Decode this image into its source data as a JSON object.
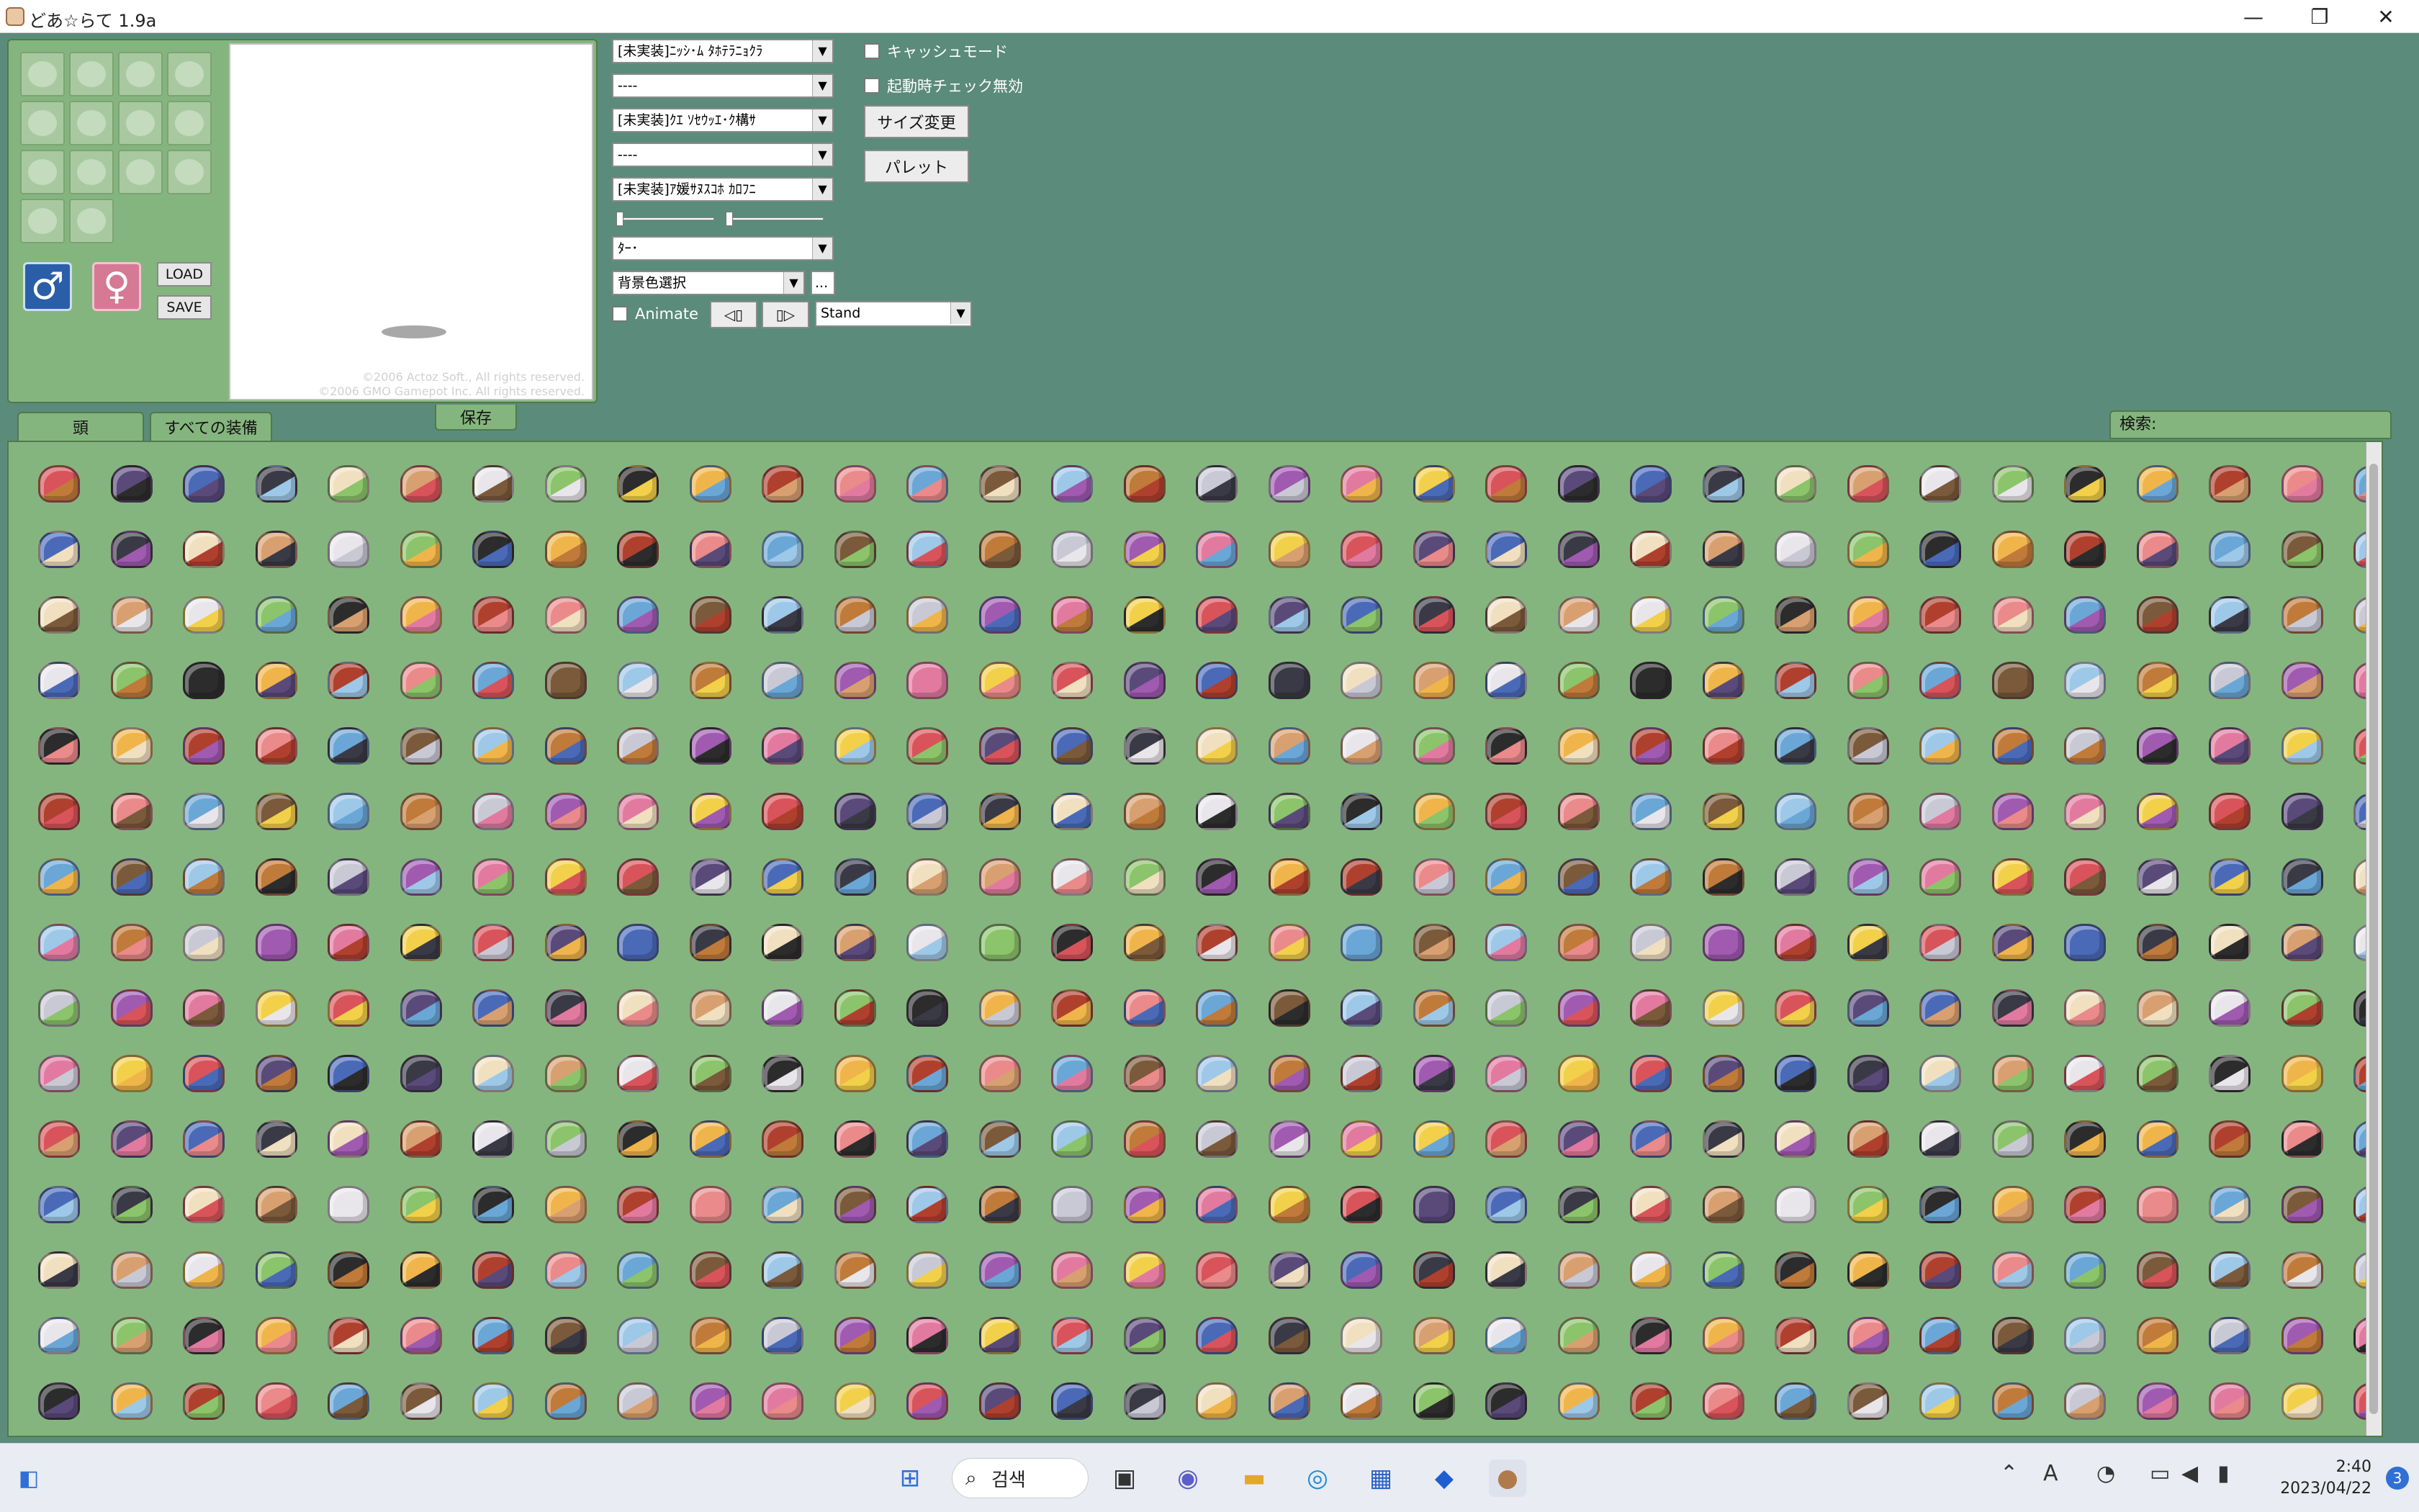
{
  "window": {
    "title": "どあ☆らて 1.9a",
    "minimize_glyph": "—",
    "restore_glyph": "❐",
    "close_glyph": "✕"
  },
  "equip_panel": {
    "slot_icons": [
      "hat-upper-icon",
      "glasses-icon",
      "hat-mid-icon",
      "weapon-icon",
      "shield-icon",
      "armor-icon",
      "helmet-icon",
      "accessory-icon",
      "glove-icon",
      "shoes-icon",
      "boots-icon",
      "face-icon",
      "hand-icon",
      "ring-icon"
    ],
    "male_glyph": "♂",
    "female_glyph": "♀",
    "load_label": "LOAD",
    "save_label": "SAVE",
    "copyright_1": "©2006 Actoz Soft., All rights reserved.",
    "copyright_2": "©2006 GMO Gamepot Inc. All rights reserved."
  },
  "controls": {
    "combo_1": "[未実装]ﾆｯｼ･ﾑ ﾀﾎﾃﾗﾆｮｸﾗ",
    "combo_2": "----",
    "combo_3": "[未実装]ｸｴ ｿｾｳｯｴ･ｸ構ｻ",
    "combo_4": "----",
    "combo_5": "[未実装]ｱ媛ｻﾇｽｺﾎ ｶﾛﾌﾆ",
    "combo_6": "ﾀｰ･",
    "bg_color": "背景色選択",
    "bg_more": "...",
    "animate_label": "Animate",
    "prev_frame": "◁▯",
    "next_frame": "▯▷",
    "motion": "Stand",
    "cache_mode_label": "キャッシュモード",
    "startup_check_label": "起動時チェック無効",
    "resize_label": "サイズ変更",
    "palette_label": "パレット"
  },
  "tabs": {
    "head": "頭",
    "all_equipment": "すべての装備",
    "save": "保存",
    "search_label": "検索:"
  },
  "item_palette": [
    "#d8545a",
    "#3a3a46",
    "#e8e6ea",
    "#f0b54a",
    "#6aa7d6",
    "#c07a3a",
    "#e27aa0",
    "#5a4a7a",
    "#f0e0c0",
    "#8bc46a",
    "#b0402e",
    "#7a5a3a",
    "#c9c9d6",
    "#f2d04a",
    "#4a6ab8",
    "#d8a070",
    "#2c2c2c",
    "#ea8a8a",
    "#9ec8e8",
    "#a05ab0"
  ],
  "item_count": 495,
  "taskbar": {
    "search_label": "검색",
    "search_glyph": "⌕",
    "ime_glyph": "A",
    "time": "2:40",
    "date": "2023/04/22",
    "notification_count": "3"
  }
}
